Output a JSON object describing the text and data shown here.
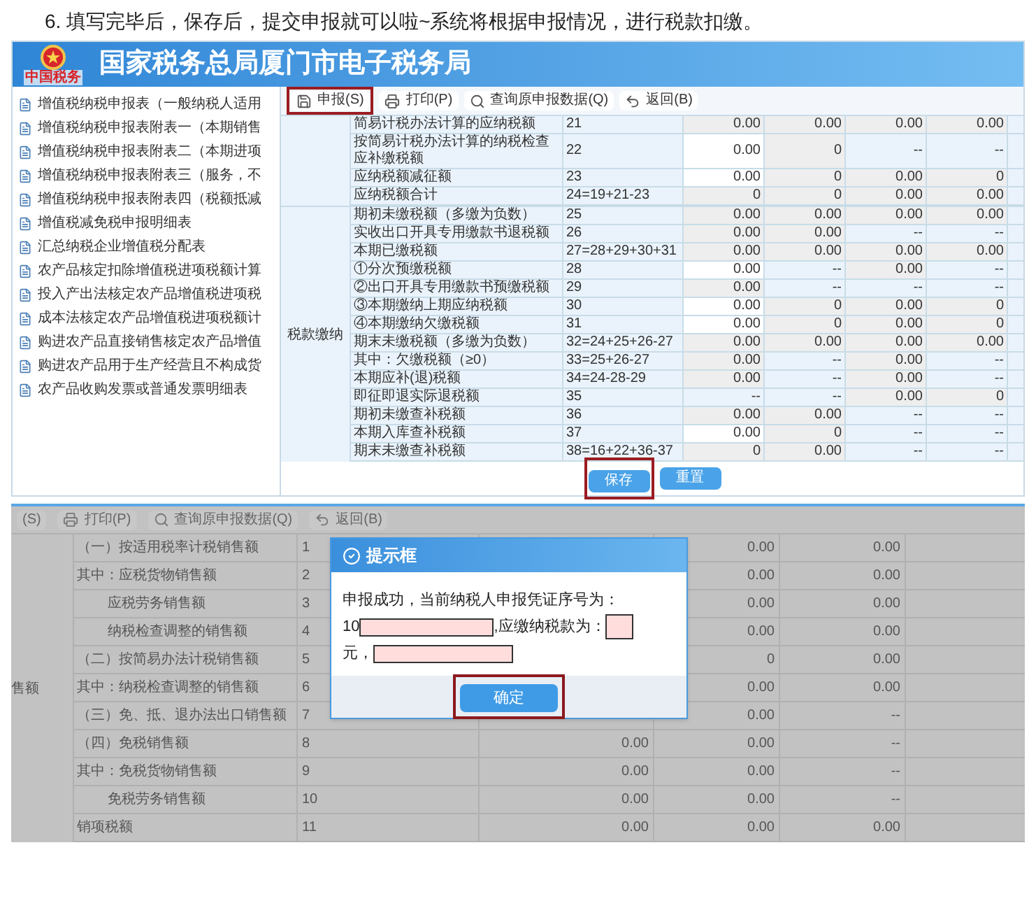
{
  "caption": "6. 填写完毕后，保存后，提交申报就可以啦~系统将根据申报情况，进行税款扣缴。",
  "screen1": {
    "header": {
      "logo_text": "中国税务",
      "title": "国家税务总局厦门市电子税务局"
    },
    "tree": [
      "增值税纳税申报表（一般纳税人适用",
      "增值税纳税申报表附表一（本期销售",
      "增值税纳税申报表附表二（本期进项",
      "增值税纳税申报表附表三（服务，不",
      "增值税纳税申报表附表四（税额抵减",
      "增值税减免税申报明细表",
      "汇总纳税企业增值税分配表",
      "农产品核定扣除增值税进项税额计算",
      "投入产出法核定农产品增值税进项税",
      "成本法核定农产品增值税进项税额计",
      "购进农产品直接销售核定农产品增值",
      "购进农产品用于生产经营且不构成货",
      "农产品收购发票或普通发票明细表"
    ],
    "toolbar": [
      {
        "kind": "save",
        "label": "申报(S)",
        "highlighted": true
      },
      {
        "kind": "print",
        "label": "打印(P)",
        "highlighted": false
      },
      {
        "kind": "search",
        "label": "查询原申报数据(Q)",
        "highlighted": false
      },
      {
        "kind": "back",
        "label": "返回(B)",
        "highlighted": false
      }
    ],
    "sections": [
      {
        "rows": [
          {
            "label": "简易计税办法计算的应纳税额",
            "formula": "21",
            "cells": [
              {
                "v": "0.00",
                "kind": "calc"
              },
              {
                "v": "0.00",
                "kind": "calc"
              },
              {
                "v": "0.00",
                "kind": "calc"
              },
              {
                "v": "0.00",
                "kind": "calc"
              }
            ]
          },
          {
            "label": "按简易计税办法计算的纳税检查应补缴税额",
            "formula": "22",
            "cells": [
              {
                "v": "0.00",
                "kind": "input"
              },
              {
                "v": "0",
                "kind": "calc"
              },
              {
                "v": "--",
                "kind": "na"
              },
              {
                "v": "--",
                "kind": "na"
              }
            ]
          },
          {
            "label": "应纳税额减征额",
            "formula": "23",
            "cells": [
              {
                "v": "0.00",
                "kind": "input"
              },
              {
                "v": "0",
                "kind": "calc"
              },
              {
                "v": "0.00",
                "kind": "calc"
              },
              {
                "v": "0",
                "kind": "calc"
              }
            ]
          },
          {
            "label": "应纳税额合计",
            "formula": "24=19+21-23",
            "cells": [
              {
                "v": "0",
                "kind": "calc"
              },
              {
                "v": "0",
                "kind": "calc"
              },
              {
                "v": "0.00",
                "kind": "calc"
              },
              {
                "v": "0.00",
                "kind": "calc"
              }
            ]
          }
        ]
      },
      {
        "group": "税款缴纳",
        "rows": [
          {
            "label": "期初未缴税额（多缴为负数）",
            "formula": "25",
            "cells": [
              {
                "v": "0.00",
                "kind": "calc"
              },
              {
                "v": "0.00",
                "kind": "calc"
              },
              {
                "v": "0.00",
                "kind": "calc"
              },
              {
                "v": "0.00",
                "kind": "calc"
              }
            ]
          },
          {
            "label": "实收出口开具专用缴款书退税额",
            "formula": "26",
            "cells": [
              {
                "v": "0.00",
                "kind": "calc"
              },
              {
                "v": "0.00",
                "kind": "calc"
              },
              {
                "v": "--",
                "kind": "na"
              },
              {
                "v": "--",
                "kind": "na"
              }
            ]
          },
          {
            "label": "本期已缴税额",
            "formula": "27=28+29+30+31",
            "cells": [
              {
                "v": "0.00",
                "kind": "calc"
              },
              {
                "v": "0.00",
                "kind": "calc"
              },
              {
                "v": "0.00",
                "kind": "calc"
              },
              {
                "v": "0.00",
                "kind": "calc"
              }
            ]
          },
          {
            "label": "①分次预缴税额",
            "formula": "28",
            "cells": [
              {
                "v": "0.00",
                "kind": "input"
              },
              {
                "v": "--",
                "kind": "na"
              },
              {
                "v": "0.00",
                "kind": "calc"
              },
              {
                "v": "--",
                "kind": "na"
              }
            ]
          },
          {
            "label": "②出口开具专用缴款书预缴税额",
            "formula": "29",
            "cells": [
              {
                "v": "0.00",
                "kind": "calc"
              },
              {
                "v": "--",
                "kind": "na"
              },
              {
                "v": "--",
                "kind": "na"
              },
              {
                "v": "--",
                "kind": "na"
              }
            ]
          },
          {
            "label": "③本期缴纳上期应纳税额",
            "formula": "30",
            "cells": [
              {
                "v": "0.00",
                "kind": "input"
              },
              {
                "v": "0",
                "kind": "calc"
              },
              {
                "v": "0.00",
                "kind": "calc"
              },
              {
                "v": "0",
                "kind": "calc"
              }
            ]
          },
          {
            "label": "④本期缴纳欠缴税额",
            "formula": "31",
            "cells": [
              {
                "v": "0.00",
                "kind": "input"
              },
              {
                "v": "0",
                "kind": "calc"
              },
              {
                "v": "0.00",
                "kind": "calc"
              },
              {
                "v": "0",
                "kind": "calc"
              }
            ]
          },
          {
            "label": "期末未缴税额（多缴为负数）",
            "formula": "32=24+25+26-27",
            "cells": [
              {
                "v": "0.00",
                "kind": "calc"
              },
              {
                "v": "0.00",
                "kind": "calc"
              },
              {
                "v": "0.00",
                "kind": "calc"
              },
              {
                "v": "0.00",
                "kind": "calc"
              }
            ]
          },
          {
            "label": "其中：欠缴税额（≥0）",
            "formula": "33=25+26-27",
            "cells": [
              {
                "v": "0.00",
                "kind": "calc"
              },
              {
                "v": "--",
                "kind": "na"
              },
              {
                "v": "0.00",
                "kind": "calc"
              },
              {
                "v": "--",
                "kind": "na"
              }
            ]
          },
          {
            "label": "本期应补(退)税额",
            "formula": "34=24-28-29",
            "cells": [
              {
                "v": "0.00",
                "kind": "calc"
              },
              {
                "v": "--",
                "kind": "na"
              },
              {
                "v": "0.00",
                "kind": "calc"
              },
              {
                "v": "--",
                "kind": "na"
              }
            ]
          },
          {
            "label": "即征即退实际退税额",
            "formula": "35",
            "cells": [
              {
                "v": "--",
                "kind": "na"
              },
              {
                "v": "--",
                "kind": "na"
              },
              {
                "v": "0.00",
                "kind": "calc"
              },
              {
                "v": "0",
                "kind": "calc"
              }
            ]
          },
          {
            "label": "期初未缴查补税额",
            "formula": "36",
            "cells": [
              {
                "v": "0.00",
                "kind": "calc"
              },
              {
                "v": "0.00",
                "kind": "calc"
              },
              {
                "v": "--",
                "kind": "na"
              },
              {
                "v": "--",
                "kind": "na"
              }
            ]
          },
          {
            "label": "本期入库查补税额",
            "formula": "37",
            "cells": [
              {
                "v": "0.00",
                "kind": "input"
              },
              {
                "v": "0",
                "kind": "calc"
              },
              {
                "v": "--",
                "kind": "na"
              },
              {
                "v": "--",
                "kind": "na"
              }
            ]
          },
          {
            "label": "期末未缴查补税额",
            "formula": "38=16+22+36-37",
            "cells": [
              {
                "v": "0",
                "kind": "calc"
              },
              {
                "v": "0.00",
                "kind": "calc"
              },
              {
                "v": "--",
                "kind": "na"
              },
              {
                "v": "--",
                "kind": "na"
              }
            ]
          }
        ]
      }
    ],
    "buttons": [
      {
        "label": "保存",
        "highlighted": true
      },
      {
        "label": "重置",
        "highlighted": false
      }
    ]
  },
  "screen2": {
    "toolbar": [
      {
        "kind": "fragment",
        "label": "(S)"
      },
      {
        "kind": "print",
        "label": "打印(P)"
      },
      {
        "kind": "search",
        "label": "查询原申报数据(Q)"
      },
      {
        "kind": "back",
        "label": "返回(B)"
      }
    ],
    "group": "售额",
    "rows": [
      {
        "label": "（一）按适用税率计税销售额",
        "kind": "main",
        "number": "1",
        "cells": [
          null,
          "0.00",
          "0.00"
        ]
      },
      {
        "label": "其中：应税货物销售额",
        "kind": "main",
        "number": "2",
        "cells": [
          null,
          "0.00",
          "0.00"
        ]
      },
      {
        "label": "应税劳务销售额",
        "kind": "sub",
        "number": "3",
        "cells": [
          null,
          "0.00",
          "0.00"
        ]
      },
      {
        "label": "纳税检查调整的销售额",
        "kind": "sub",
        "number": "4",
        "cells": [
          null,
          "0.00",
          "0.00"
        ]
      },
      {
        "label": "（二）按简易办法计税销售额",
        "kind": "main",
        "number": "5",
        "cells": [
          null,
          "0",
          "0.00"
        ]
      },
      {
        "label": "其中：纳税检查调整的销售额",
        "kind": "main",
        "number": "6",
        "cells": [
          null,
          "0.00",
          "0.00"
        ]
      },
      {
        "label": "（三）免、抵、退办法出口销售额",
        "kind": "main",
        "number": "7",
        "cells": [
          null,
          "0.00",
          "--"
        ]
      },
      {
        "label": "（四）免税销售额",
        "kind": "main",
        "number": "8",
        "cells": [
          "0.00",
          "0.00",
          "--"
        ]
      },
      {
        "label": "其中：免税货物销售额",
        "kind": "main",
        "number": "9",
        "cells": [
          "0.00",
          "0.00",
          "--"
        ]
      },
      {
        "label": "免税劳务销售额",
        "kind": "sub",
        "number": "10",
        "cells": [
          "0.00",
          "0.00",
          "--"
        ]
      },
      {
        "label": "销项税额",
        "kind": "main",
        "number": "11",
        "cells": [
          "0.00",
          "0.00",
          "0.00"
        ]
      }
    ],
    "dialog": {
      "title": "提示框",
      "line1": "申报成功，当前纳税人申报凭证序号为：",
      "serial_prefix": "10",
      "tax_label": ",应缴纳税款为：",
      "unit": "元，",
      "button": {
        "label": "确定",
        "highlighted": true
      }
    }
  }
}
